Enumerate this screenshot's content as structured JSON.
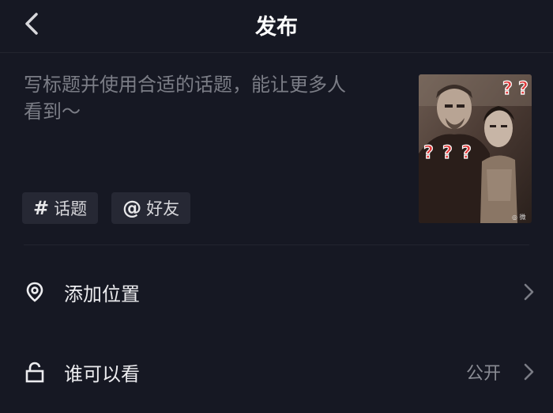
{
  "header": {
    "title": "发布",
    "back_icon": "chevron-left-icon"
  },
  "caption": {
    "placeholder_line1": "写标题并使用合适的话题，能让更多人",
    "placeholder_line2": "看到～"
  },
  "chips": [
    {
      "symbol": "#",
      "label": "话题",
      "icon": "hashtag-icon"
    },
    {
      "symbol": "@",
      "label": "好友",
      "icon": "at-icon"
    }
  ],
  "thumbnail": {
    "marks": [
      "?",
      "?",
      "?",
      "?",
      "?"
    ],
    "watermark": "◎ 微"
  },
  "settings": [
    {
      "label": "添加位置",
      "value": "",
      "icon": "location-pin-icon"
    },
    {
      "label": "谁可以看",
      "value": "公开",
      "icon": "unlock-icon"
    }
  ],
  "colors": {
    "background": "#161823",
    "chip_background": "#262834",
    "placeholder_text": "#7b7d86",
    "question_mark": "#e03b3b"
  }
}
